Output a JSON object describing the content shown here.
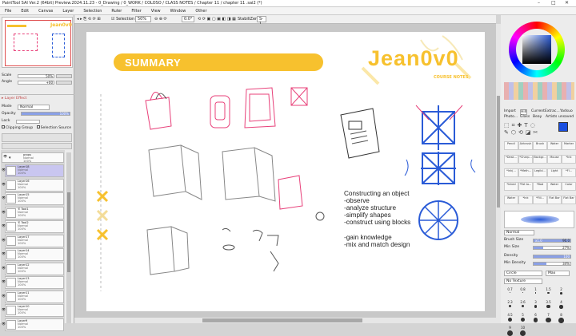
{
  "window": {
    "title": "PaintTool SAI Ver.2 (64bit) Preview.2024.11.23 - 0_Drawing / 0_WORK / COLOSO / CLASS NOTES / Chapter 11 / chapter  11 .sai2 (*)",
    "min": "–",
    "max": "□",
    "close": "✕"
  },
  "menu": [
    "File",
    "Edit",
    "Canvas",
    "Layer",
    "Selection",
    "Ruler",
    "Filter",
    "View",
    "Window",
    "Other"
  ],
  "toolbar": {
    "selection_label": "Selection",
    "zoom": "50%",
    "angle": "0.0°",
    "stabilizer_label": "StabiliZer",
    "stabilizer_value": "S-1"
  },
  "left": {
    "nav_logo": "Jean0v0",
    "scale_label": "Scale",
    "scale_value": "50%",
    "angle_label": "Angle",
    "angle_value": "+00",
    "layer_effect": "Layer Effect",
    "mode_label": "Mode",
    "mode_value": "Normal",
    "opacity_label": "Opacity",
    "opacity_value": "100%",
    "lock_label": "Lock",
    "clipping_group": "Clipping Group",
    "selection_source": "Selection Source",
    "folder_name": "props",
    "folder_mode": "Normal",
    "folder_opacity": "100%",
    "layers": [
      {
        "name": "Layer18",
        "mode": "Normal",
        "opacity": "100%",
        "selected": true
      },
      {
        "name": "Layer16",
        "mode": "Normal",
        "opacity": "100%"
      },
      {
        "name": "Layer15",
        "mode": "Normal",
        "opacity": "100%"
      },
      {
        "name": "'E Tool1",
        "mode": "Normal",
        "opacity": "100%"
      },
      {
        "name": "'E Tool2",
        "mode": "Normal",
        "opacity": "100%"
      },
      {
        "name": "Layer17",
        "mode": "Normal",
        "opacity": "100%"
      },
      {
        "name": "Layer14",
        "mode": "Normal",
        "opacity": "100%"
      },
      {
        "name": "Layer12",
        "mode": "Normal",
        "opacity": "100%"
      },
      {
        "name": "Layer13",
        "mode": "Normal",
        "opacity": "100%"
      },
      {
        "name": "Layer11",
        "mode": "Normal",
        "opacity": "100%"
      },
      {
        "name": "Layer10",
        "mode": "Normal",
        "opacity": "100%"
      },
      {
        "name": "Layer9",
        "mode": "Normal",
        "opacity": "100%"
      }
    ]
  },
  "canvas": {
    "summary": "SUMMARY",
    "logo": "Jean0v0",
    "course_notes": "COURSE NOTES",
    "notes": [
      "Constructing an object",
      "-observe",
      "-analyze structure",
      "-simplify shapes",
      "-construct using blocks",
      "",
      "-gain knowledge",
      "-mix and match design"
    ],
    "colors": {
      "yellow": "#f7c12e",
      "pink": "#e8417a",
      "blue": "#2a5bd7",
      "gray": "#9a9a9a"
    }
  },
  "right": {
    "tabs": [
      "Import",
      "Hill",
      "Current",
      "Extrac...",
      "Yadsuo",
      "Photo...",
      "Glass",
      "Beay",
      "Artists",
      "unsaved"
    ],
    "brushes": [
      "Pencil",
      "Airbrush",
      "Brush",
      "Water",
      "Marker",
      "*Desk...",
      "*Charp...",
      "Backgr...",
      "Mouse",
      "*Ink",
      "*Ink(...",
      "*Meth...",
      "Legibl...",
      "Light",
      "*Fl...",
      "*Inked",
      "*Fat to...",
      "*Bad",
      "Water",
      "Color",
      "Water",
      "*Ink",
      "*Fill...",
      "Flat Bar",
      "Flat Bar"
    ],
    "mode_value": "Normal",
    "brush_size_label": "Brush Size",
    "brush_size_mult": "x1.0",
    "brush_size_value": "90.0",
    "min_size_label": "Min Size",
    "min_size_value": "27%",
    "density_label": "Density",
    "density_value": "100",
    "min_density_label": "Min Density",
    "min_density_value": "34%",
    "circle_label": "Circle",
    "circle_value": "Max",
    "texture_label": "No Texture",
    "sizes": [
      "0.7",
      "0.8",
      "1",
      "1.5",
      "2",
      "2.3",
      "2.6",
      "3",
      "3.5",
      "4",
      "4.5",
      "5",
      "6",
      "7",
      "8",
      "9",
      "10"
    ]
  }
}
